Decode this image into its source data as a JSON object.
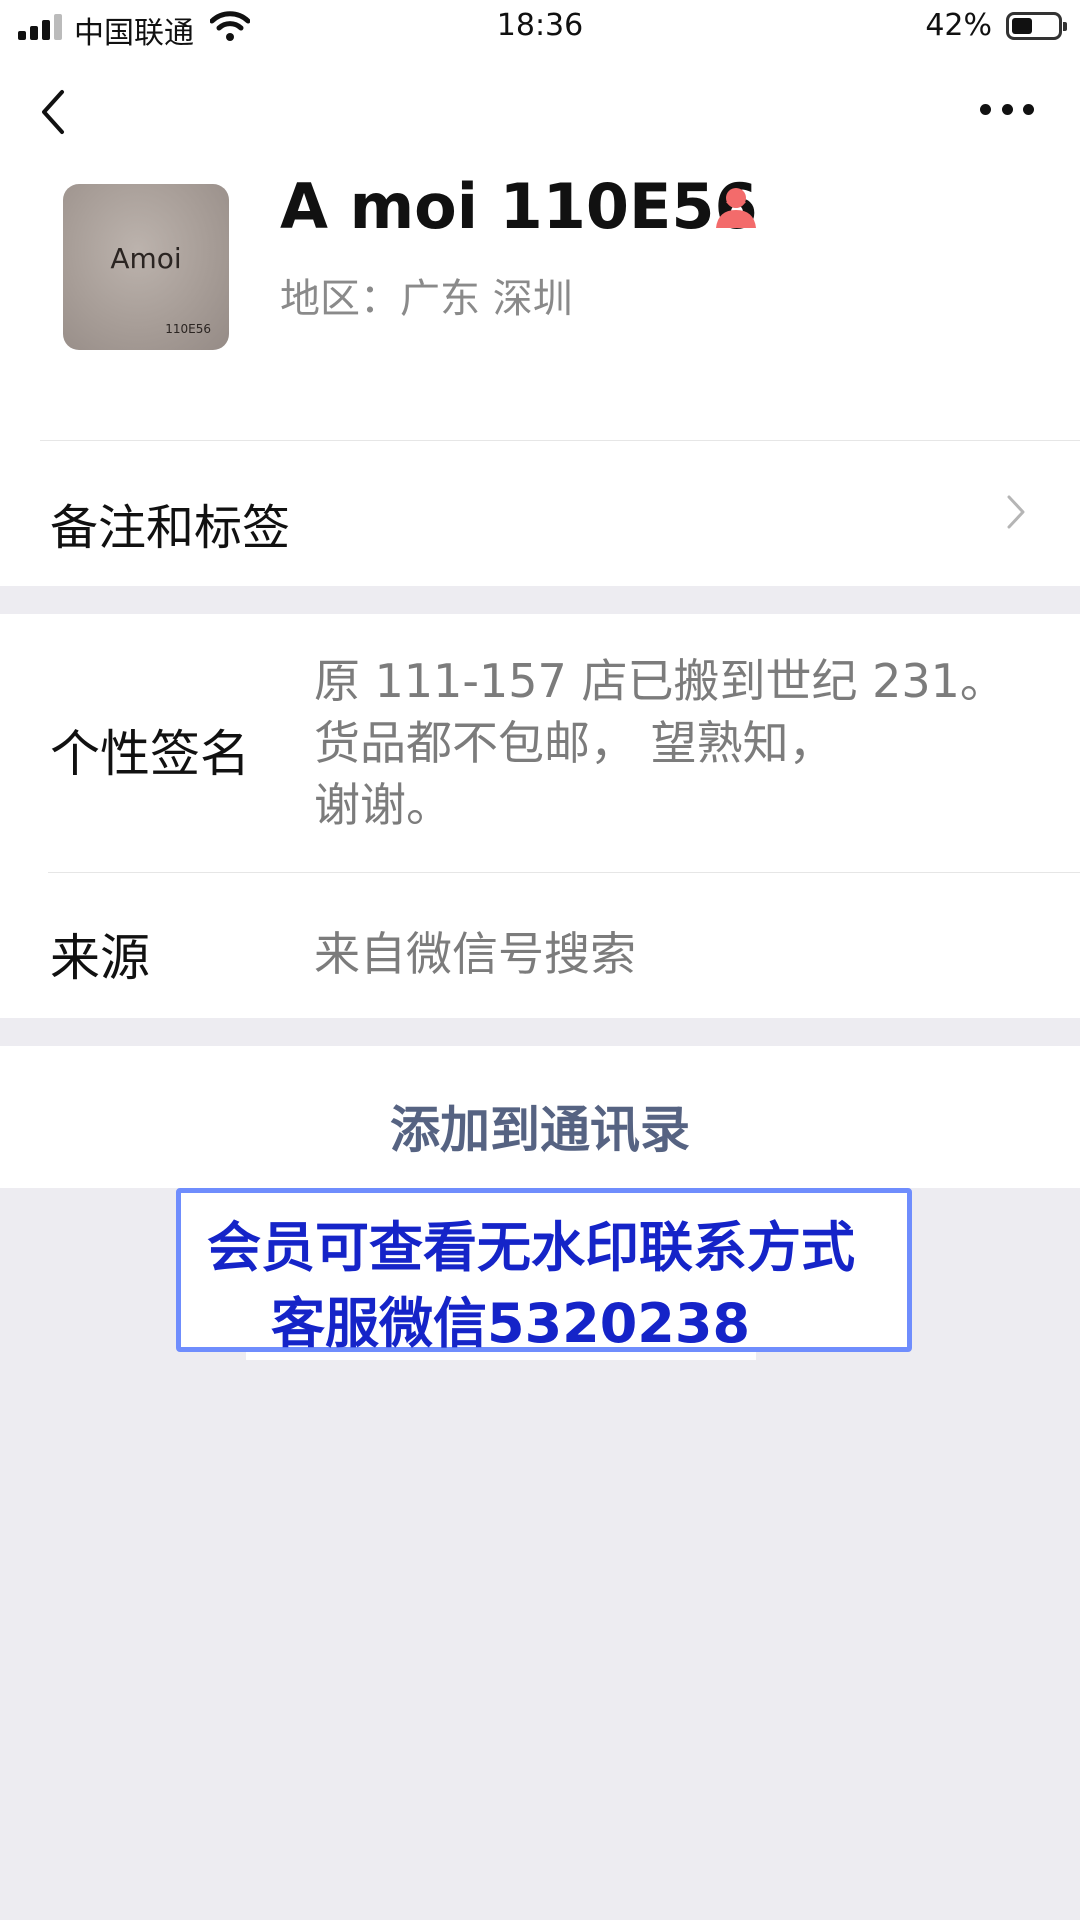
{
  "status_bar": {
    "carrier": "中国联通",
    "time": "18:36",
    "battery": "42%",
    "battery_level": 0.42
  },
  "header": {
    "back_icon": "chevron-left-icon",
    "more_icon": "ellipsis-icon"
  },
  "profile": {
    "avatar_brand": "Amoi",
    "avatar_model": "110E56",
    "name": "A moi 110E56",
    "gender_icon": "female-icon",
    "gender_color": "#f36b6b",
    "region": "地区：广东 深圳"
  },
  "remark_row": {
    "label": "备注和标签"
  },
  "signature": {
    "label": "个性签名",
    "lines": [
      "原 111-157 店已搬到世纪 231。",
      "货品都不包邮， 望熟知，",
      "谢谢。"
    ]
  },
  "source": {
    "label": "来源",
    "value": "来自微信号搜索"
  },
  "add_button": {
    "label": "添加到通讯录",
    "color": "#566382"
  },
  "watermark": {
    "line1": "会员可查看无水印联系方式",
    "line2": "客服微信5320238",
    "text_color": "#1524c8",
    "border_color": "#6f8dfd"
  }
}
